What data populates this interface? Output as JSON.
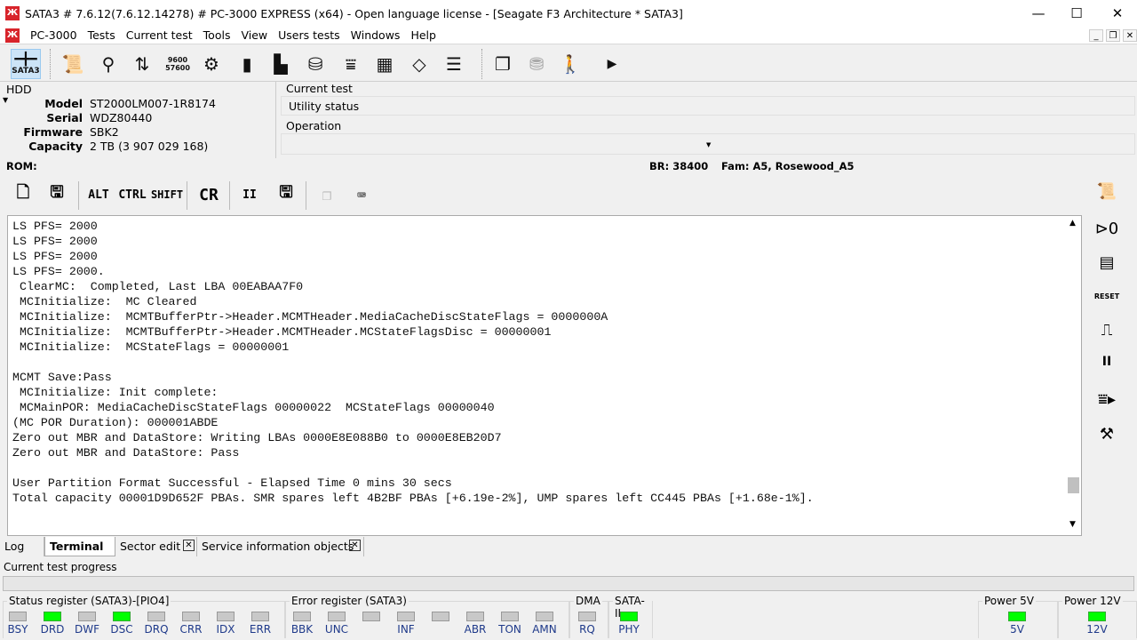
{
  "window": {
    "title": "SATA3 # 7.6.12(7.6.12.14278) # PC-3000 EXPRESS (x64) - Open language license - [Seagate F3 Architecture * SATA3]",
    "app_icon": "pc3000-icon",
    "minimize": "—",
    "maximize": "☐",
    "close": "✕"
  },
  "menu": [
    "PC-3000",
    "Tests",
    "Current test",
    "Tools",
    "View",
    "Users tests",
    "Windows",
    "Help"
  ],
  "toolbar": {
    "sata3_label": "SATA3"
  },
  "hdd": {
    "title": "HDD",
    "model_label": "Model",
    "model": "ST2000LM007-1R8174",
    "serial_label": "Serial",
    "serial": "WDZ80440",
    "firmware_label": "Firmware",
    "firmware": "SBK2",
    "capacity_label": "Capacity",
    "capacity": "2 TB (3 907 029 168)"
  },
  "current_test": {
    "title": "Current test",
    "value": "Utility status",
    "operation_label": "Operation"
  },
  "rom": {
    "label": "ROM:",
    "br": "BR: 38400",
    "fam": "Fam: A5, Rosewood_A5"
  },
  "terminal_toolbar": {
    "alt": "ALT",
    "ctrl": "CTRL",
    "shift": "SHIFT",
    "cr": "CR",
    "pause": "II"
  },
  "terminal_lines": [
    "LS PFS= 2000",
    "LS PFS= 2000",
    "LS PFS= 2000",
    "LS PFS= 2000.",
    " ClearMC:  Completed, Last LBA 00EABAA7F0",
    " MCInitialize:  MC Cleared",
    " MCInitialize:  MCMTBufferPtr->Header.MCMTHeader.MediaCacheDiscStateFlags = 0000000A",
    " MCInitialize:  MCMTBufferPtr->Header.MCMTHeader.MCStateFlagsDisc = 00000001",
    " MCInitialize:  MCStateFlags = 00000001",
    "",
    "MCMT Save:Pass",
    " MCInitialize: Init complete:",
    " MCMainPOR: MediaCacheDiscStateFlags 00000022  MCStateFlags 00000040",
    "(MC POR Duration): 000001ABDE",
    "Zero out MBR and DataStore: Writing LBAs 0000E8E088B0 to 0000E8EB20D7",
    "Zero out MBR and DataStore: Pass",
    "",
    "User Partition Format Successful - Elapsed Time 0 mins 30 secs",
    "Total capacity 00001D9D652F PBAs. SMR spares left 4B2BF PBAs [+6.19e-2%], UMP spares left CC445 PBAs [+1.68e-1%]."
  ],
  "tabs": [
    {
      "label": "Log"
    },
    {
      "label": "Terminal"
    },
    {
      "label": "Sector edit"
    },
    {
      "label": "Service information objects"
    }
  ],
  "progress": {
    "label": "Current test progress",
    "value": 0
  },
  "status_register": {
    "title": "Status register (SATA3)-[PIO4]",
    "leds": [
      {
        "l": "BSY",
        "on": false
      },
      {
        "l": "DRD",
        "on": true
      },
      {
        "l": "DWF",
        "on": false
      },
      {
        "l": "DSC",
        "on": true
      },
      {
        "l": "DRQ",
        "on": false
      },
      {
        "l": "CRR",
        "on": false
      },
      {
        "l": "IDX",
        "on": false
      },
      {
        "l": "ERR",
        "on": false
      }
    ]
  },
  "error_register": {
    "title": "Error register (SATA3)",
    "leds": [
      {
        "l": "BBK",
        "on": false
      },
      {
        "l": "UNC",
        "on": false
      },
      {
        "l": "",
        "on": false
      },
      {
        "l": "INF",
        "on": false
      },
      {
        "l": "",
        "on": false
      },
      {
        "l": "ABR",
        "on": false
      },
      {
        "l": "TON",
        "on": false
      },
      {
        "l": "AMN",
        "on": false
      }
    ]
  },
  "dma": {
    "title": "DMA",
    "led": "RQ",
    "on": false
  },
  "sata2": {
    "title": "SATA-II",
    "led": "PHY",
    "on": true
  },
  "power5": {
    "title": "Power 5V",
    "led": "5V",
    "on": true
  },
  "power12": {
    "title": "Power 12V",
    "led": "12V",
    "on": true
  },
  "colors": {
    "led_on": "#00ff00",
    "led_off": "#c8c8c8",
    "selected": "#cce4f7"
  }
}
